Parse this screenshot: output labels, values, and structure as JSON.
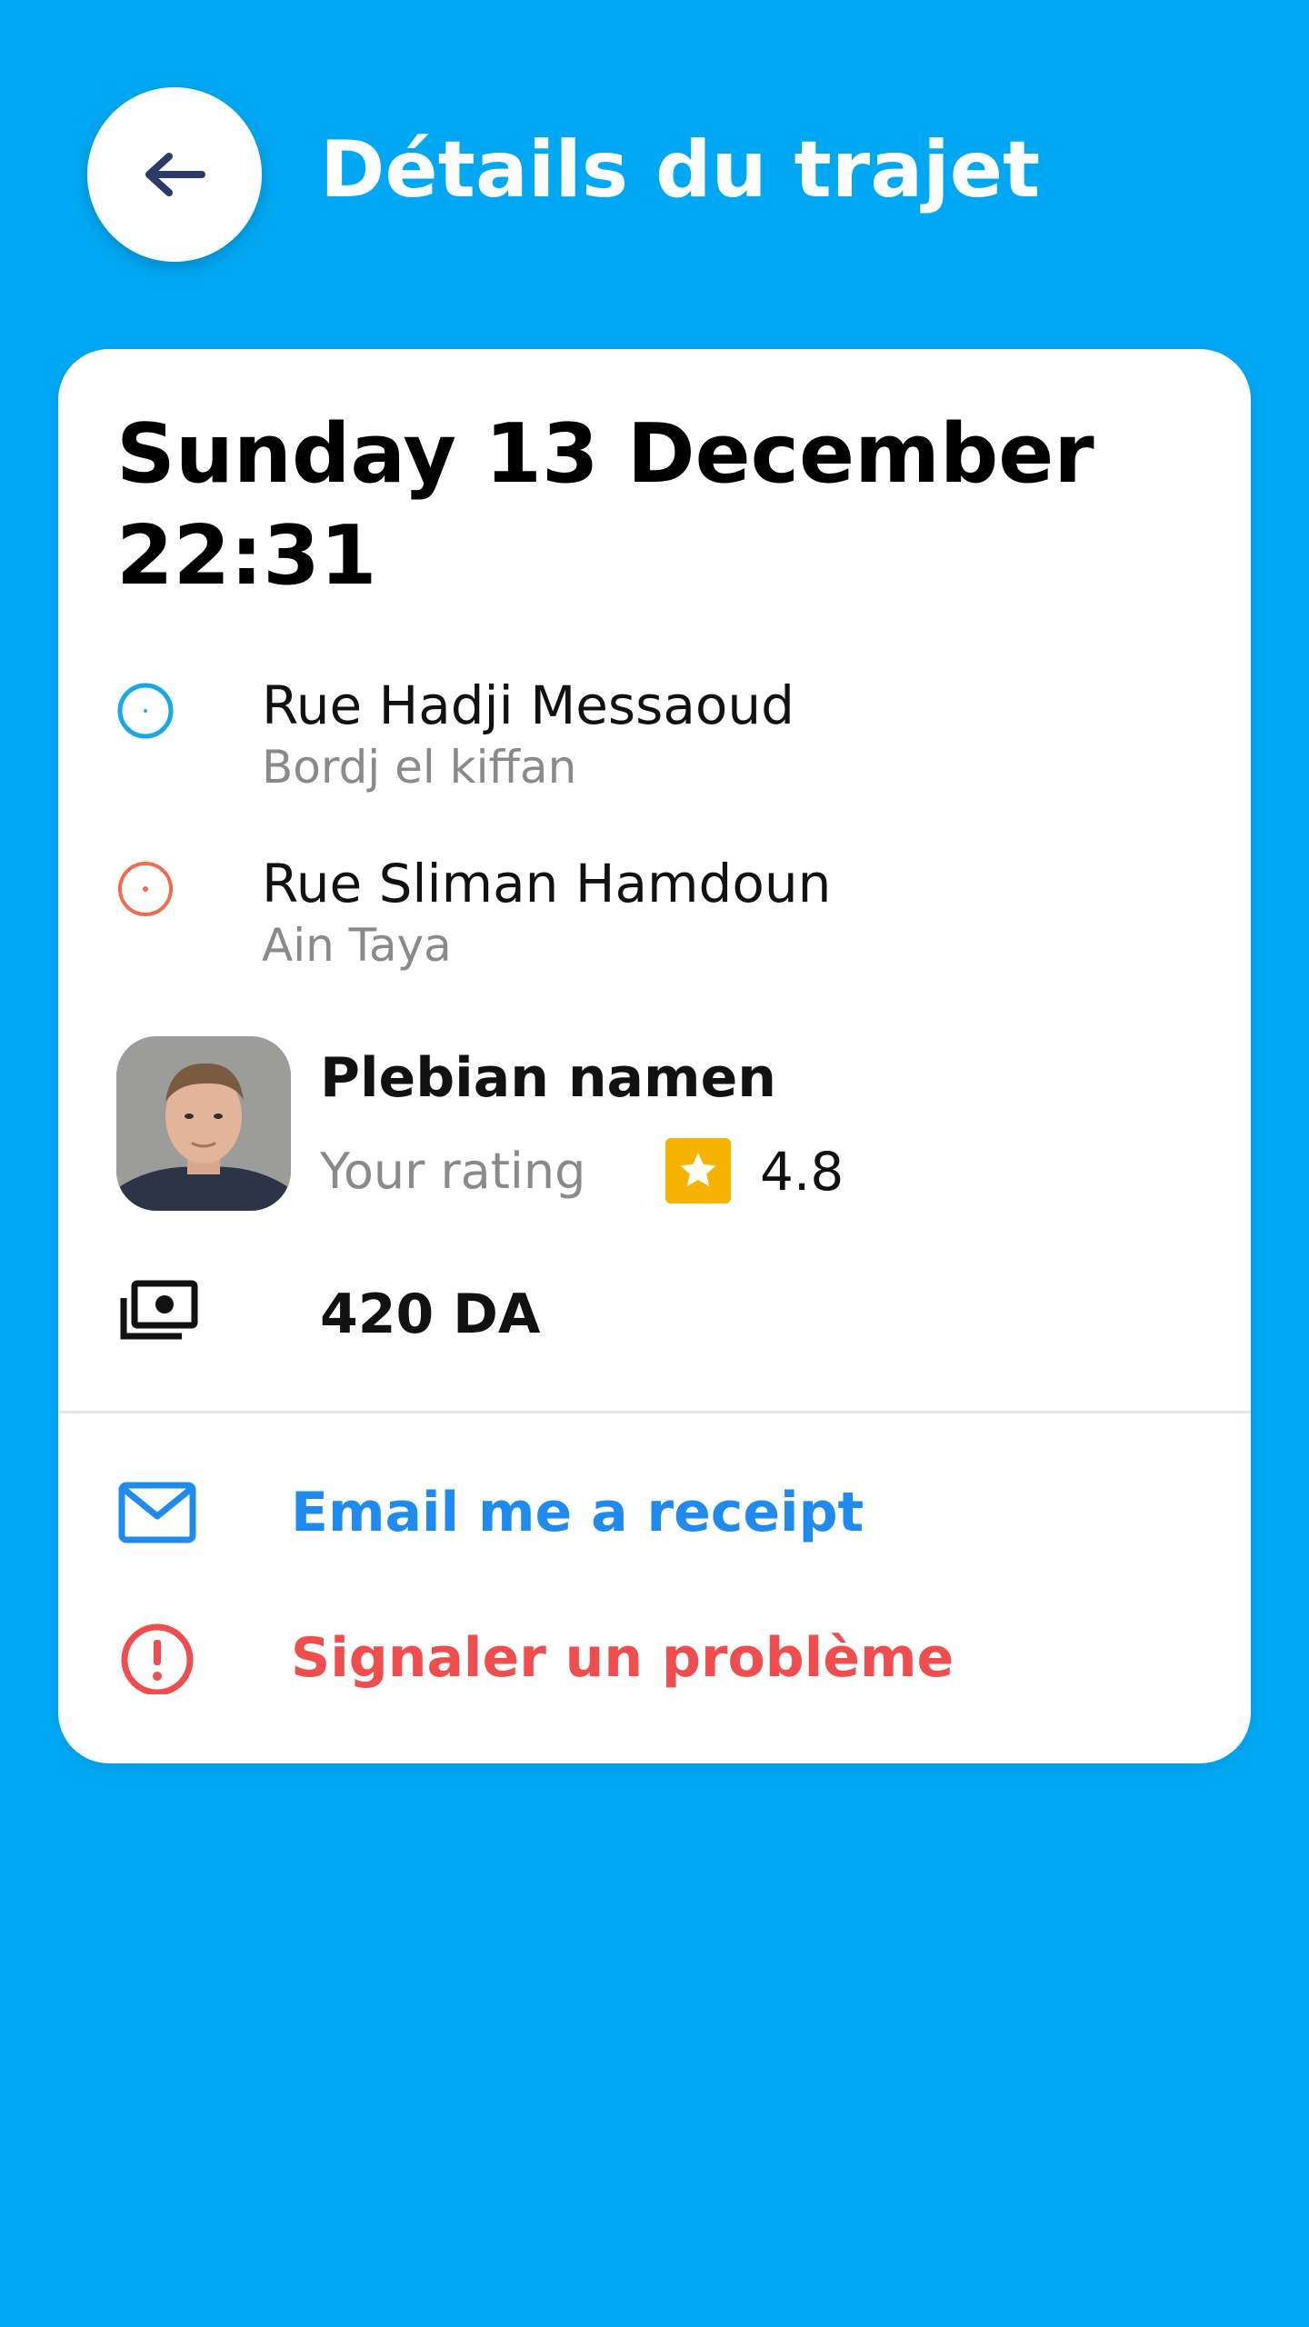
{
  "header": {
    "title": "Détails du trajet",
    "back_icon": "arrow-left-icon"
  },
  "trip": {
    "date_line1": "Sunday 13 December",
    "date_line2": "22:31",
    "pickup": {
      "street": "Rue Hadji Messaoud",
      "city": "Bordj el kiffan",
      "marker_color": "#1aa7e8"
    },
    "dropoff": {
      "street": "Rue Sliman Hamdoun",
      "city": "Ain Taya",
      "marker_color": "#f26b4b"
    }
  },
  "driver": {
    "name": "Plebian namen",
    "rating_label": "Your rating",
    "rating_value": "4.8",
    "star_color": "#f8b300"
  },
  "price": {
    "amount": "420 DA",
    "icon": "money-icon"
  },
  "actions": {
    "email_receipt": "Email me a receipt",
    "report_problem": "Signaler un problème"
  },
  "colors": {
    "background": "#00a8f3",
    "email_blue": "#1f8bef",
    "problem_red": "#f04e4e",
    "back_arrow": "#2e3a67"
  }
}
